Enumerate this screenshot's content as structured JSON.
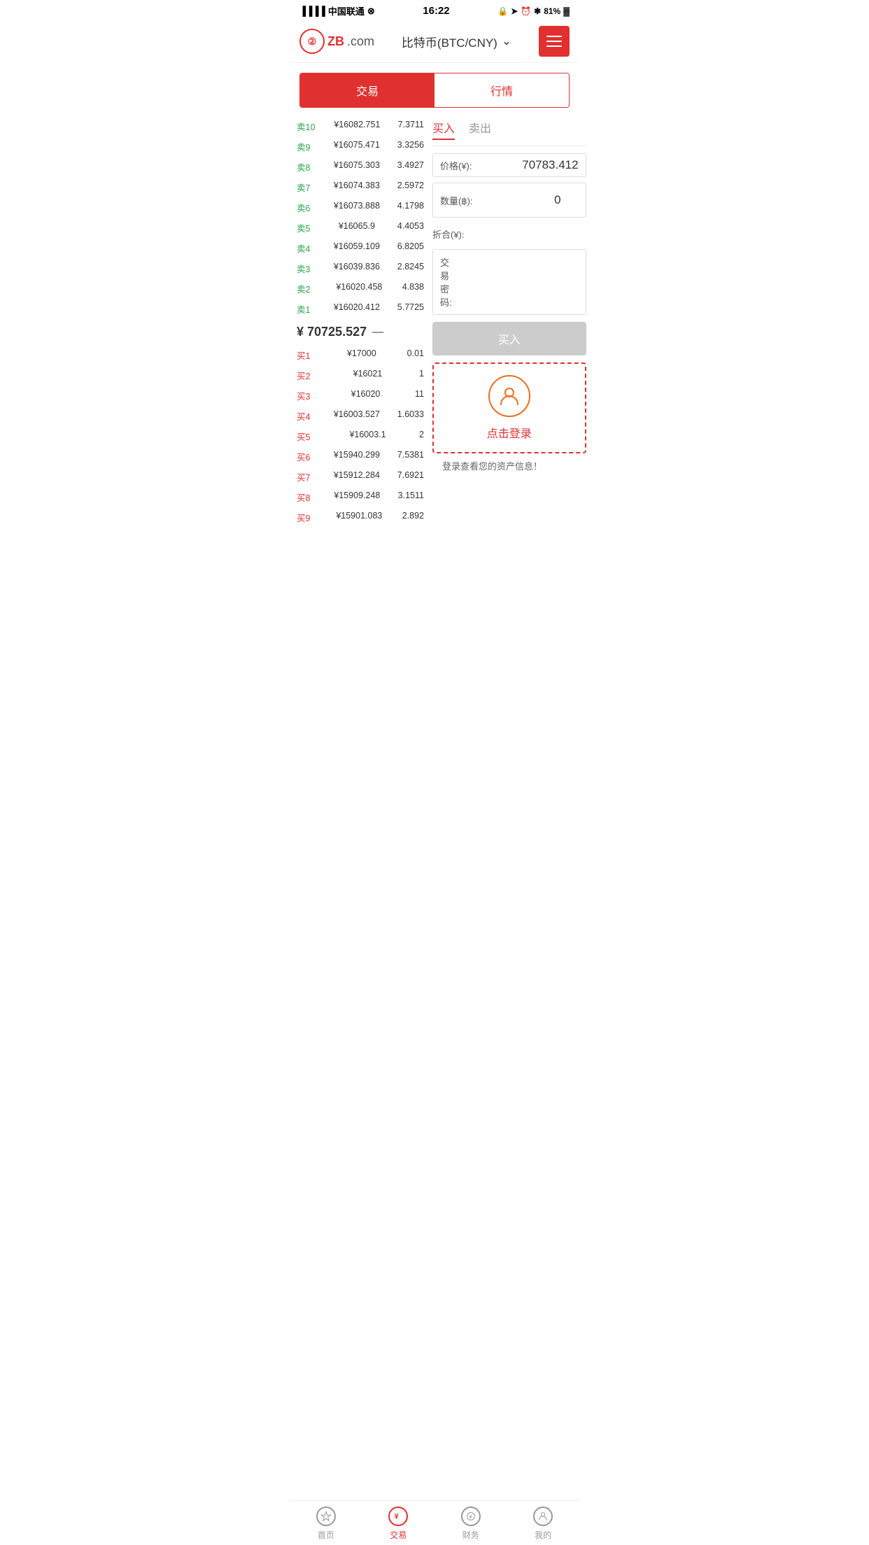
{
  "statusBar": {
    "carrier": "中国联通",
    "time": "16:22",
    "battery": "81%"
  },
  "header": {
    "logo": "ZB.com",
    "title": "比特币(BTC/CNY)",
    "menuIcon": "☰"
  },
  "tabs": [
    {
      "label": "交易",
      "active": true
    },
    {
      "label": "行情",
      "active": false
    }
  ],
  "orderBook": {
    "sellOrders": [
      {
        "label": "卖10",
        "price": "¥16082.751",
        "qty": "7.3711"
      },
      {
        "label": "卖9",
        "price": "¥16075.471",
        "qty": "3.3256"
      },
      {
        "label": "卖8",
        "price": "¥16075.303",
        "qty": "3.4927"
      },
      {
        "label": "卖7",
        "price": "¥16074.383",
        "qty": "2.5972"
      },
      {
        "label": "卖6",
        "price": "¥16073.888",
        "qty": "4.1798"
      },
      {
        "label": "卖5",
        "price": "¥16065.9",
        "qty": "4.4053"
      },
      {
        "label": "卖4",
        "price": "¥16059.109",
        "qty": "6.8205"
      },
      {
        "label": "卖3",
        "price": "¥16039.836",
        "qty": "2.8245"
      },
      {
        "label": "卖2",
        "price": "¥16020.458",
        "qty": "4.838"
      },
      {
        "label": "卖1",
        "price": "¥16020.412",
        "qty": "5.7725"
      }
    ],
    "currentPrice": "¥ 70725.527",
    "priceIndicator": "—",
    "buyOrders": [
      {
        "label": "买1",
        "price": "¥17000",
        "qty": "0.01"
      },
      {
        "label": "买2",
        "price": "¥16021",
        "qty": "1"
      },
      {
        "label": "买3",
        "price": "¥16020",
        "qty": "11"
      },
      {
        "label": "买4",
        "price": "¥16003.527",
        "qty": "1.6033"
      },
      {
        "label": "买5",
        "price": "¥16003.1",
        "qty": "2"
      },
      {
        "label": "买6",
        "price": "¥15940.299",
        "qty": "7.5381"
      },
      {
        "label": "买7",
        "price": "¥15912.284",
        "qty": "7.6921"
      },
      {
        "label": "买8",
        "price": "¥15909.248",
        "qty": "3.1511"
      },
      {
        "label": "买9",
        "price": "¥15901.083",
        "qty": "2.892"
      }
    ]
  },
  "tradePanel": {
    "buySellTabs": [
      {
        "label": "买入",
        "active": true
      },
      {
        "label": "卖出",
        "active": false
      }
    ],
    "priceLabel": "价格(¥):",
    "priceValue": "70783.412",
    "qtyLabel": "数量(฿):",
    "qtyValue": "0",
    "totalLabel": "折合(¥):",
    "totalValue": "",
    "passwordLabel": "交易密码:",
    "passwordValue": "",
    "buyBtnLabel": "买入"
  },
  "loginBox": {
    "loginText": "点击登录",
    "assetInfo": "登录查看您的资产信息！"
  },
  "bottomNav": [
    {
      "label": "首页",
      "icon": "star",
      "active": false
    },
    {
      "label": "交易",
      "icon": "yen",
      "active": true
    },
    {
      "label": "财务",
      "icon": "bag",
      "active": false
    },
    {
      "label": "我的",
      "icon": "user",
      "active": false
    }
  ]
}
